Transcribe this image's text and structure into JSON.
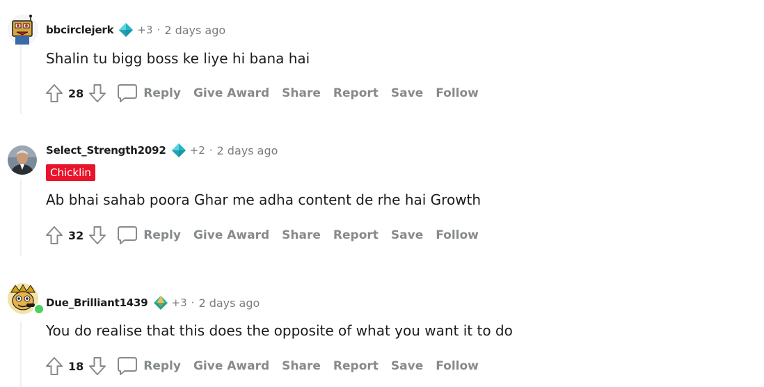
{
  "comments": [
    {
      "username": "bbcirclejerk",
      "award_count": "+3",
      "separator": "·",
      "time": "2 days ago",
      "flair": "",
      "body": "Shalin tu bigg boss ke liye hi bana hai",
      "score": "28",
      "actions": [
        "Reply",
        "Give Award",
        "Share",
        "Report",
        "Save",
        "Follow"
      ]
    },
    {
      "username": "Select_Strength2092",
      "award_count": "+2",
      "separator": "·",
      "time": "2 days ago",
      "flair": "Chicklin",
      "body": "Ab bhai sahab poora Ghar me adha content de rhe hai Growth",
      "score": "32",
      "actions": [
        "Reply",
        "Give Award",
        "Share",
        "Report",
        "Save",
        "Follow"
      ]
    },
    {
      "username": "Due_Brilliant1439",
      "award_count": "+3",
      "separator": "·",
      "time": "2 days ago",
      "flair": "",
      "body": "You do realise that this does the opposite of what you want it to do",
      "score": "18",
      "actions": [
        "Reply",
        "Give Award",
        "Share",
        "Report",
        "Save",
        "Follow"
      ]
    }
  ],
  "icons": {
    "upvote": "upvote-arrow-icon",
    "downvote": "downvote-arrow-icon",
    "reply": "speech-bubble-icon",
    "award_diamond": "diamond-award-icon",
    "award_gem": "gem-award-icon"
  },
  "colors": {
    "flair_bg": "#e8142b",
    "muted_text": "#7c7c7c",
    "action_text": "#878a8c",
    "online": "#46d160",
    "thread_line": "#edeff1"
  }
}
